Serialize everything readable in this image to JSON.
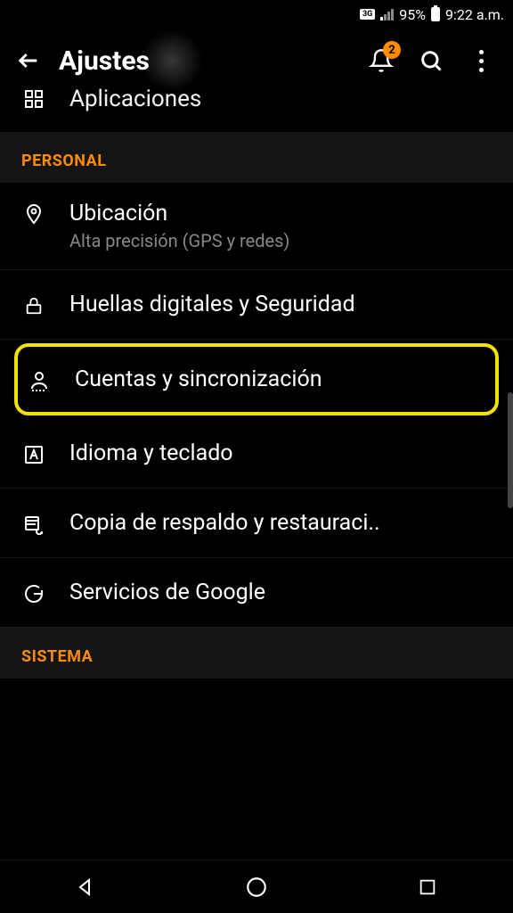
{
  "status": {
    "network": "3G",
    "battery_percent": "95%",
    "time": "9:22 a.m."
  },
  "header": {
    "title": "Ajustes",
    "notification_count": "2"
  },
  "partial_item": {
    "label": "Aplicaciones"
  },
  "sections": {
    "personal": {
      "title": "PERSONAL",
      "items": [
        {
          "label": "Ubicación",
          "sub": "Alta precisión (GPS y redes)"
        },
        {
          "label": "Huellas digitales y Seguridad"
        },
        {
          "label": "Cuentas y sincronización"
        },
        {
          "label": "Idioma y teclado"
        },
        {
          "label": "Copia de respaldo y restauraci.."
        },
        {
          "label": "Servicios de Google"
        }
      ]
    },
    "sistema": {
      "title": "SISTEMA"
    }
  }
}
